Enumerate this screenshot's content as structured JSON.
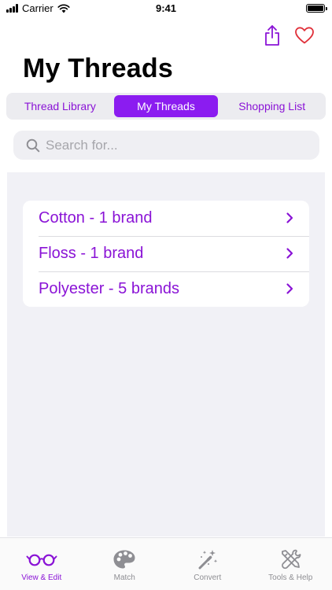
{
  "status_bar": {
    "carrier": "Carrier",
    "time": "9:41"
  },
  "header": {
    "title": "My Threads",
    "share_icon": "share-icon",
    "favorite_icon": "heart-icon"
  },
  "segments": [
    {
      "label": "Thread Library",
      "active": false
    },
    {
      "label": "My Threads",
      "active": true
    },
    {
      "label": "Shopping List",
      "active": false
    }
  ],
  "search": {
    "placeholder": "Search for...",
    "value": ""
  },
  "thread_list": [
    {
      "label": "Cotton - 1 brand"
    },
    {
      "label": "Floss - 1 brand"
    },
    {
      "label": "Polyester - 5 brands"
    }
  ],
  "tab_bar": [
    {
      "label": "View & Edit",
      "icon": "glasses-icon",
      "active": true
    },
    {
      "label": "Match",
      "icon": "palette-icon",
      "active": false
    },
    {
      "label": "Convert",
      "icon": "magic-wand-icon",
      "active": false
    },
    {
      "label": "Tools & Help",
      "icon": "tools-icon",
      "active": false
    }
  ],
  "colors": {
    "accent": "#8a13d6",
    "segment_active": "#8b1cf0",
    "background_list": "#f1f1f6",
    "tab_inactive": "#8e8e93"
  }
}
